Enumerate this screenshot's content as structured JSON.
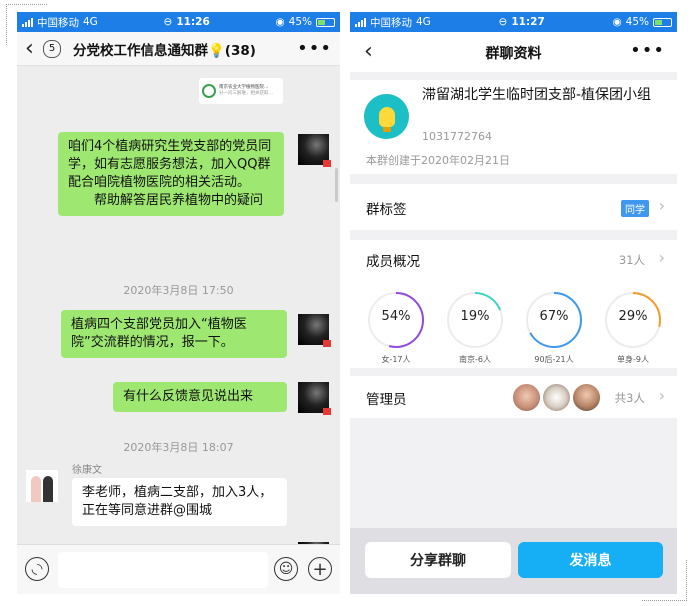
{
  "left": {
    "status": {
      "carrier": "中国移动",
      "network": "4G",
      "time": "11:26",
      "battery": "45%"
    },
    "nav": {
      "unread": "5",
      "title": "分党校工作信息通知群💡(38)"
    },
    "messages": [
      {
        "text": "咱们4个植病研究生党支部的党员同学，如有志愿服务想法，加入QQ群配合咱院植物医院的相关活动。\n　　帮助解答居民养植物中的疑问"
      },
      {
        "text": "植病四个支部党员加入“植物医院”交流群的情况，报一下。"
      },
      {
        "text": "有什么反馈意见说出来"
      },
      {
        "sender": "徐康文",
        "text": "李老师，植病二支部，加入3人，正在等同意进群@围城"
      }
    ],
    "timestamps": [
      "2020年3月8日 17:50",
      "2020年3月8日 18:07"
    ],
    "news_card": {
      "line1": "南京农业大学植物医院…",
      "line2": "分一问三解难，相关获取…"
    }
  },
  "right": {
    "status": {
      "carrier": "中国移动",
      "network": "4G",
      "time": "11:27",
      "battery": "45%"
    },
    "nav": {
      "title": "群聊资料"
    },
    "group": {
      "name": "滞留湖北学生临时团支部-植保团小组",
      "id": "1031772764",
      "created": "本群创建于2020年02月21日"
    },
    "tags": {
      "label": "群标签",
      "tag": "同学"
    },
    "members": {
      "label": "成员概况",
      "count": "31人",
      "stats": [
        {
          "pct": "54%",
          "caption": "女-17人",
          "value": 0.54,
          "color": "#8f4be0"
        },
        {
          "pct": "19%",
          "caption": "南京-6人",
          "value": 0.19,
          "color": "#41d3c6"
        },
        {
          "pct": "67%",
          "caption": "90后-21人",
          "value": 0.67,
          "color": "#3f98ee"
        },
        {
          "pct": "29%",
          "caption": "单身-9人",
          "value": 0.29,
          "color": "#f59b2b"
        }
      ]
    },
    "admins": {
      "label": "管理员",
      "count": "共3人"
    },
    "buttons": {
      "share": "分享群聊",
      "send": "发消息"
    }
  }
}
